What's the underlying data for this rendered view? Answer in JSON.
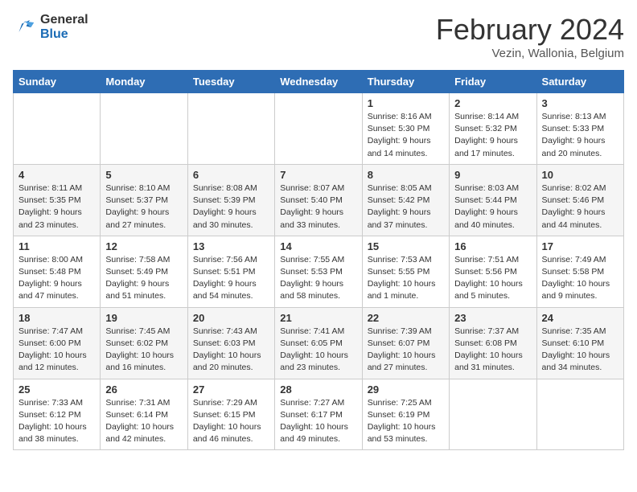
{
  "logo": {
    "general": "General",
    "blue": "Blue"
  },
  "header": {
    "month": "February 2024",
    "location": "Vezin, Wallonia, Belgium"
  },
  "days_of_week": [
    "Sunday",
    "Monday",
    "Tuesday",
    "Wednesday",
    "Thursday",
    "Friday",
    "Saturday"
  ],
  "weeks": [
    [
      {
        "day": "",
        "info": ""
      },
      {
        "day": "",
        "info": ""
      },
      {
        "day": "",
        "info": ""
      },
      {
        "day": "",
        "info": ""
      },
      {
        "day": "1",
        "info": "Sunrise: 8:16 AM\nSunset: 5:30 PM\nDaylight: 9 hours\nand 14 minutes."
      },
      {
        "day": "2",
        "info": "Sunrise: 8:14 AM\nSunset: 5:32 PM\nDaylight: 9 hours\nand 17 minutes."
      },
      {
        "day": "3",
        "info": "Sunrise: 8:13 AM\nSunset: 5:33 PM\nDaylight: 9 hours\nand 20 minutes."
      }
    ],
    [
      {
        "day": "4",
        "info": "Sunrise: 8:11 AM\nSunset: 5:35 PM\nDaylight: 9 hours\nand 23 minutes."
      },
      {
        "day": "5",
        "info": "Sunrise: 8:10 AM\nSunset: 5:37 PM\nDaylight: 9 hours\nand 27 minutes."
      },
      {
        "day": "6",
        "info": "Sunrise: 8:08 AM\nSunset: 5:39 PM\nDaylight: 9 hours\nand 30 minutes."
      },
      {
        "day": "7",
        "info": "Sunrise: 8:07 AM\nSunset: 5:40 PM\nDaylight: 9 hours\nand 33 minutes."
      },
      {
        "day": "8",
        "info": "Sunrise: 8:05 AM\nSunset: 5:42 PM\nDaylight: 9 hours\nand 37 minutes."
      },
      {
        "day": "9",
        "info": "Sunrise: 8:03 AM\nSunset: 5:44 PM\nDaylight: 9 hours\nand 40 minutes."
      },
      {
        "day": "10",
        "info": "Sunrise: 8:02 AM\nSunset: 5:46 PM\nDaylight: 9 hours\nand 44 minutes."
      }
    ],
    [
      {
        "day": "11",
        "info": "Sunrise: 8:00 AM\nSunset: 5:48 PM\nDaylight: 9 hours\nand 47 minutes."
      },
      {
        "day": "12",
        "info": "Sunrise: 7:58 AM\nSunset: 5:49 PM\nDaylight: 9 hours\nand 51 minutes."
      },
      {
        "day": "13",
        "info": "Sunrise: 7:56 AM\nSunset: 5:51 PM\nDaylight: 9 hours\nand 54 minutes."
      },
      {
        "day": "14",
        "info": "Sunrise: 7:55 AM\nSunset: 5:53 PM\nDaylight: 9 hours\nand 58 minutes."
      },
      {
        "day": "15",
        "info": "Sunrise: 7:53 AM\nSunset: 5:55 PM\nDaylight: 10 hours\nand 1 minute."
      },
      {
        "day": "16",
        "info": "Sunrise: 7:51 AM\nSunset: 5:56 PM\nDaylight: 10 hours\nand 5 minutes."
      },
      {
        "day": "17",
        "info": "Sunrise: 7:49 AM\nSunset: 5:58 PM\nDaylight: 10 hours\nand 9 minutes."
      }
    ],
    [
      {
        "day": "18",
        "info": "Sunrise: 7:47 AM\nSunset: 6:00 PM\nDaylight: 10 hours\nand 12 minutes."
      },
      {
        "day": "19",
        "info": "Sunrise: 7:45 AM\nSunset: 6:02 PM\nDaylight: 10 hours\nand 16 minutes."
      },
      {
        "day": "20",
        "info": "Sunrise: 7:43 AM\nSunset: 6:03 PM\nDaylight: 10 hours\nand 20 minutes."
      },
      {
        "day": "21",
        "info": "Sunrise: 7:41 AM\nSunset: 6:05 PM\nDaylight: 10 hours\nand 23 minutes."
      },
      {
        "day": "22",
        "info": "Sunrise: 7:39 AM\nSunset: 6:07 PM\nDaylight: 10 hours\nand 27 minutes."
      },
      {
        "day": "23",
        "info": "Sunrise: 7:37 AM\nSunset: 6:08 PM\nDaylight: 10 hours\nand 31 minutes."
      },
      {
        "day": "24",
        "info": "Sunrise: 7:35 AM\nSunset: 6:10 PM\nDaylight: 10 hours\nand 34 minutes."
      }
    ],
    [
      {
        "day": "25",
        "info": "Sunrise: 7:33 AM\nSunset: 6:12 PM\nDaylight: 10 hours\nand 38 minutes."
      },
      {
        "day": "26",
        "info": "Sunrise: 7:31 AM\nSunset: 6:14 PM\nDaylight: 10 hours\nand 42 minutes."
      },
      {
        "day": "27",
        "info": "Sunrise: 7:29 AM\nSunset: 6:15 PM\nDaylight: 10 hours\nand 46 minutes."
      },
      {
        "day": "28",
        "info": "Sunrise: 7:27 AM\nSunset: 6:17 PM\nDaylight: 10 hours\nand 49 minutes."
      },
      {
        "day": "29",
        "info": "Sunrise: 7:25 AM\nSunset: 6:19 PM\nDaylight: 10 hours\nand 53 minutes."
      },
      {
        "day": "",
        "info": ""
      },
      {
        "day": "",
        "info": ""
      }
    ]
  ]
}
